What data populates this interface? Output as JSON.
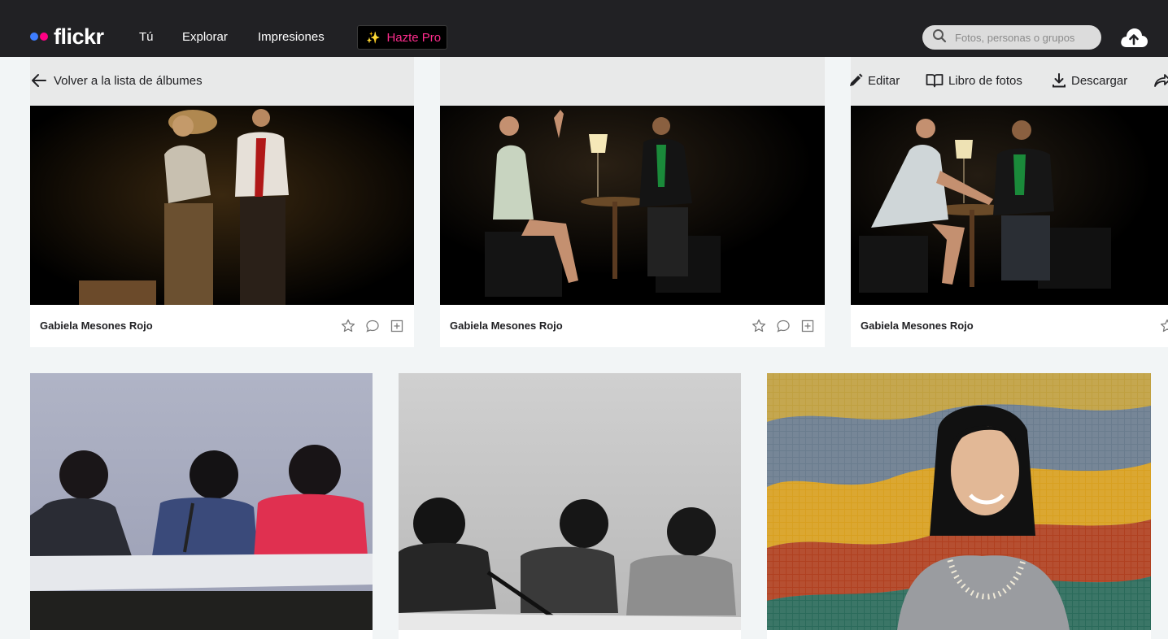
{
  "nav": {
    "logo": "flickr",
    "links": [
      "Tú",
      "Explorar",
      "Impresiones"
    ],
    "pro_label": "Hazte Pro",
    "search_placeholder": "Fotos, personas o grupos",
    "colors": {
      "bar": "#212124",
      "brand_blue": "#3d7dff",
      "brand_pink": "#ff0084",
      "pro_text": "#ff2c8d"
    }
  },
  "album_bar": {
    "back_label": "Volver a la lista de álbumes",
    "actions": [
      "Editar",
      "Libro de fotos",
      "Descargar"
    ]
  },
  "photos": [
    {
      "author": "Gabiela Mesones Rojo",
      "scene": "two actors walking on dark stage"
    },
    {
      "author": "Gabiela Mesones Rojo",
      "scene": "woman and man seated at table with lamp"
    },
    {
      "author": "Gabiela Mesones Rojo",
      "scene": "woman and man seated at table with lamp, wider shot"
    },
    {
      "author": "",
      "scene": "three women reading at table with microphone"
    },
    {
      "author": "",
      "scene": "black and white three women at table"
    },
    {
      "author": "",
      "scene": "smiling woman in front of colorful mosaic"
    }
  ]
}
